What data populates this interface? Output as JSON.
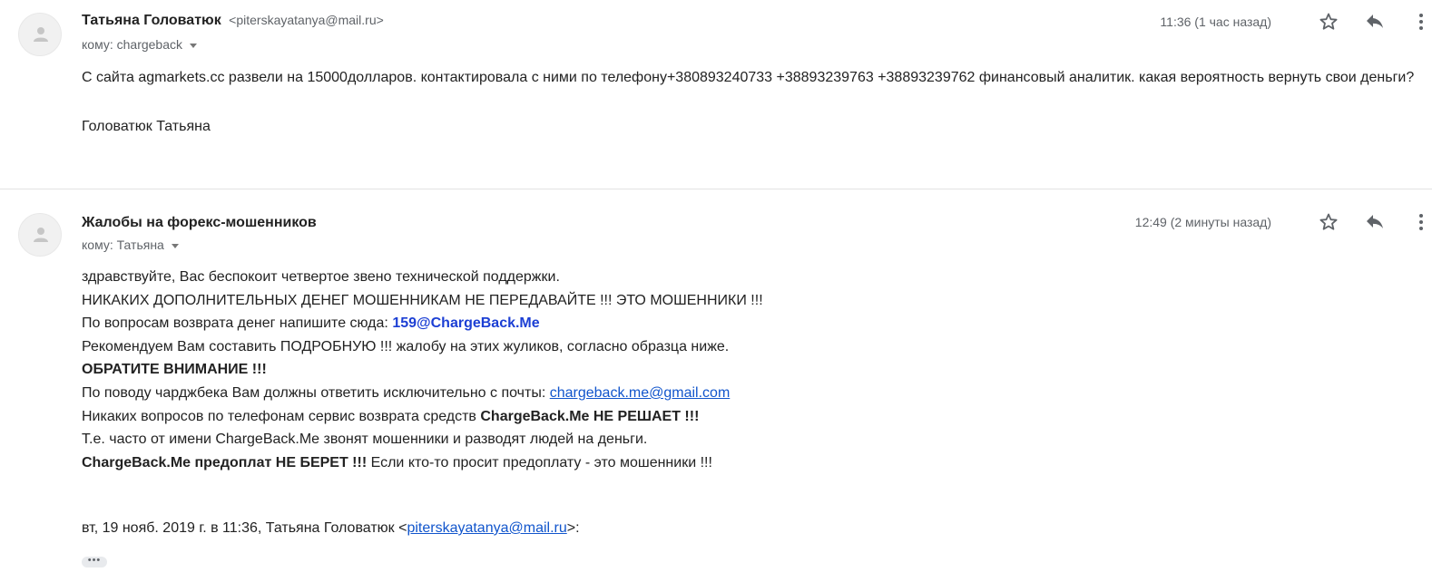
{
  "messages": [
    {
      "sender_name": "Татьяна Головатюк",
      "sender_email": "<piterskayatanya@mail.ru>",
      "to_label": "кому: chargeback",
      "time": "11:36 (1 час назад)",
      "body": {
        "line1": "С сайта agmarkets.cc  развели на 15000долларов. контактировала с ними по телефону+380893240733  +38893239763     +38893239762 финансовый аналитик. какая вероятность вернуть свои деньги?",
        "signature": "Головатюк Татьяна"
      }
    },
    {
      "sender_name": "Жалобы на форекс-мошенников",
      "to_label": "кому: Татьяна",
      "time": "12:49 (2 минуты назад)",
      "body": {
        "l1": "здравствуйте, Вас беспокоит четвертое звено технической поддержки.",
        "l2": "НИКАКИХ ДОПОЛНИТЕЛЬНЫХ ДЕНЕГ МОШЕННИКАМ НЕ ПЕРЕДАВАЙТЕ !!! ЭТО МОШЕННИКИ !!!",
        "l3_text": "По вопросам возврата денег напишите сюда: ",
        "l3_email": "159@ChargeBack.Me",
        "l4": "Рекомендуем Вам составить ПОДРОБНУЮ !!! жалобу на этих жуликов, согласно образца ниже.",
        "l5": "ОБРАТИТЕ ВНИМАНИЕ !!!",
        "l6_text": "По поводу чарджбека Вам должны ответить исключительно с почты: ",
        "l6_link": "chargeback.me@gmail.com",
        "l7_text": "Никаких вопросов по телефонам сервис возврата средств ",
        "l7_bold": "ChargeBack.Me НЕ РЕШАЕТ !!!",
        "l8": "Т.е. часто от имени ChargeBack.Me звонят мошенники и разводят людей на деньги.",
        "l9_bold": "ChargeBack.Me предоплат НЕ БЕРЕТ !!!",
        "l9_text": " Если кто-то просит предоплату - это мошенники !!!"
      },
      "quote": {
        "prefix": "вт, 19 нояб. 2019 г. в 11:36, Татьяна Головатюк <",
        "link": "piterskayatanya@mail.ru",
        "suffix": ">:"
      },
      "trimmed_label": "•••"
    }
  ],
  "icons": {
    "star": "star-icon",
    "reply": "reply-icon",
    "more": "more-vert-icon",
    "avatar": "person-icon"
  },
  "colors": {
    "link": "#1155cc",
    "bold_email": "#1c3fd4",
    "meta": "#5f6368"
  }
}
